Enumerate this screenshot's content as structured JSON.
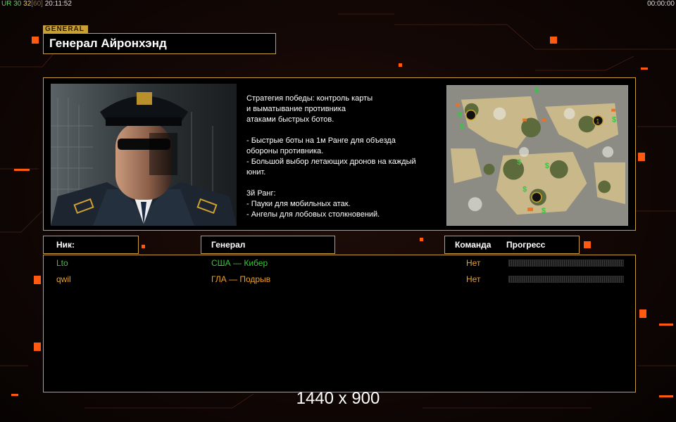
{
  "topbar": {
    "ur_label": "UR",
    "ur_value": "30",
    "fps_current": "32",
    "fps_max_bracket": "[60]",
    "clock": "20:11:52",
    "timer": "00:00:00"
  },
  "general": {
    "tag": "GENERAL",
    "name": "Генерал Айронхэнд",
    "description": "Стратегия победы: контроль карты\nи выматывание противника\nатаками быстрых ботов.\n\n- Быстрые боты на 1м Ранге для объезда\n обороны противника.\n- Большой выбор летающих дронов на каждый\n юнит.\n\n3й Ранг:\n- Пауки для мобильных атак.\n- Ангелы для лобовых столкновений."
  },
  "map": {
    "marker_1": "1"
  },
  "table": {
    "headers": {
      "nick": "Ник:",
      "general": "Генерал",
      "team": "Команда",
      "progress": "Прогресс"
    },
    "rows": [
      {
        "nick": "Lto",
        "general": "США — Кибер",
        "team": "Нет",
        "color": "#3fc23f",
        "progress": 0
      },
      {
        "nick": "qwil",
        "general": "ГЛА — Подрыв",
        "team": "Нет",
        "color": "#f0a020",
        "progress": 0
      }
    ]
  },
  "footer": {
    "resolution": "1440 x 900"
  },
  "colors": {
    "accent": "#c8a033",
    "team_text": "#f0a020"
  }
}
